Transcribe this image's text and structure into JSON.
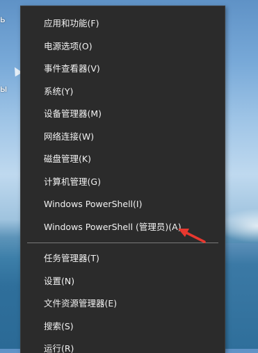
{
  "desktop": {
    "icon_fragment_1": "ь",
    "icon_fragment_2": "ы"
  },
  "menu": {
    "items_top": [
      {
        "id": "apps",
        "label": "应用和功能(F)"
      },
      {
        "id": "power",
        "label": "电源选项(O)"
      },
      {
        "id": "event-viewer",
        "label": "事件查看器(V)"
      },
      {
        "id": "system",
        "label": "系统(Y)"
      },
      {
        "id": "device-manager",
        "label": "设备管理器(M)"
      },
      {
        "id": "network",
        "label": "网络连接(W)"
      },
      {
        "id": "disk-management",
        "label": "磁盘管理(K)"
      },
      {
        "id": "computer-management",
        "label": "计算机管理(G)"
      },
      {
        "id": "powershell",
        "label": "Windows PowerShell(I)"
      },
      {
        "id": "powershell-admin",
        "label": "Windows PowerShell (管理员)(A)"
      }
    ],
    "items_bottom": [
      {
        "id": "task-manager",
        "label": "任务管理器(T)"
      },
      {
        "id": "settings",
        "label": "设置(N)"
      },
      {
        "id": "file-explorer",
        "label": "文件资源管理器(E)"
      },
      {
        "id": "search",
        "label": "搜索(S)"
      },
      {
        "id": "run",
        "label": "运行(R)"
      }
    ]
  },
  "colors": {
    "menu_background": "#2b2b2b",
    "menu_text": "#f2f2f2",
    "separator": "#7a7a7a",
    "annotation_arrow": "#e8382f"
  },
  "icons": {
    "annotation": "red-arrow-icon"
  }
}
